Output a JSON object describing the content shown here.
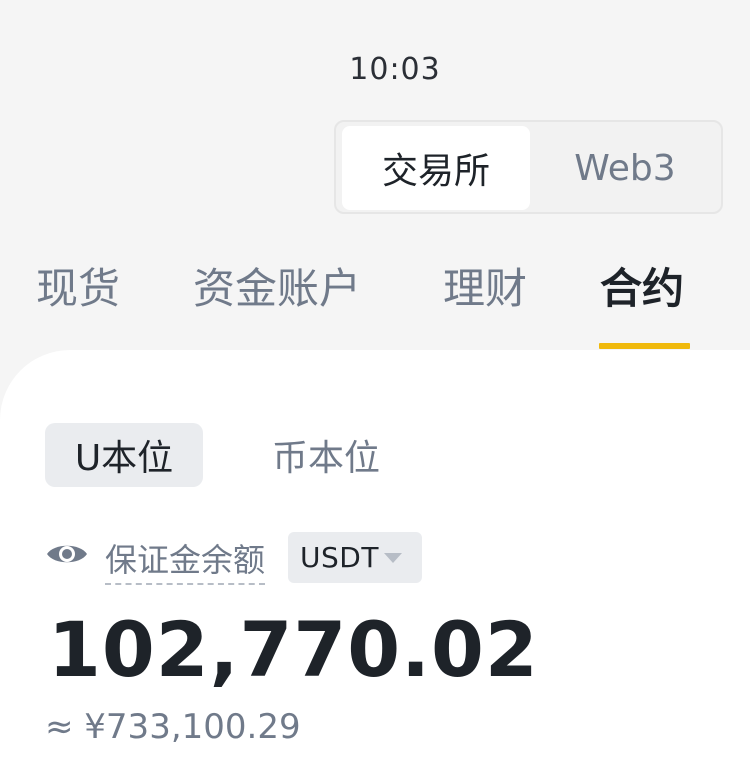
{
  "status": {
    "time": "10:03"
  },
  "mode_switch": {
    "active": "交易所",
    "inactive": "Web3"
  },
  "account_tabs": [
    {
      "label": "现货"
    },
    {
      "label": "资金账户"
    },
    {
      "label": "理财"
    },
    {
      "label": "合约"
    }
  ],
  "unit_tabs": {
    "active": "U本位",
    "inactive": "币本位"
  },
  "balance": {
    "label": "保证金余额",
    "currency": "USDT",
    "value": "102,770.02",
    "cny": "≈ ¥733,100.29"
  },
  "colors": {
    "accent": "#f0b90b",
    "text": "#1e2329",
    "muted": "#707a8a"
  }
}
